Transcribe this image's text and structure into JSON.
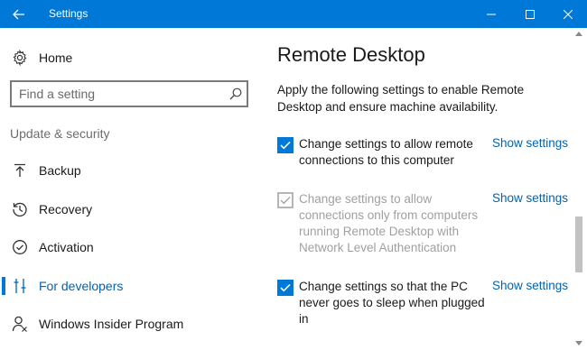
{
  "window": {
    "title": "Settings",
    "accent": "#0078d7"
  },
  "sidebar": {
    "home_label": "Home",
    "search": {
      "placeholder": "Find a setting",
      "value": ""
    },
    "section_title": "Update & security",
    "items": [
      {
        "label": "Backup",
        "icon": "backup-arrow-icon",
        "selected": false
      },
      {
        "label": "Recovery",
        "icon": "recovery-history-icon",
        "selected": false
      },
      {
        "label": "Activation",
        "icon": "activation-check-icon",
        "selected": false
      },
      {
        "label": "For developers",
        "icon": "developer-tools-icon",
        "selected": true
      },
      {
        "label": "Windows Insider Program",
        "icon": "insider-person-icon",
        "selected": false
      }
    ]
  },
  "main": {
    "title": "Remote Desktop",
    "description": "Apply the following settings to enable Remote Desktop and ensure machine availability.",
    "options": [
      {
        "label": "Change settings to allow remote connections to this computer",
        "checked": true,
        "enabled": true,
        "link": "Show settings"
      },
      {
        "label": "Change settings to allow connections only from computers running Remote Desktop with Network Level Authentication",
        "checked": true,
        "enabled": false,
        "link": "Show settings"
      },
      {
        "label": "Change settings so that the PC never goes to sleep when plugged in",
        "checked": true,
        "enabled": true,
        "link": "Show settings"
      }
    ]
  }
}
